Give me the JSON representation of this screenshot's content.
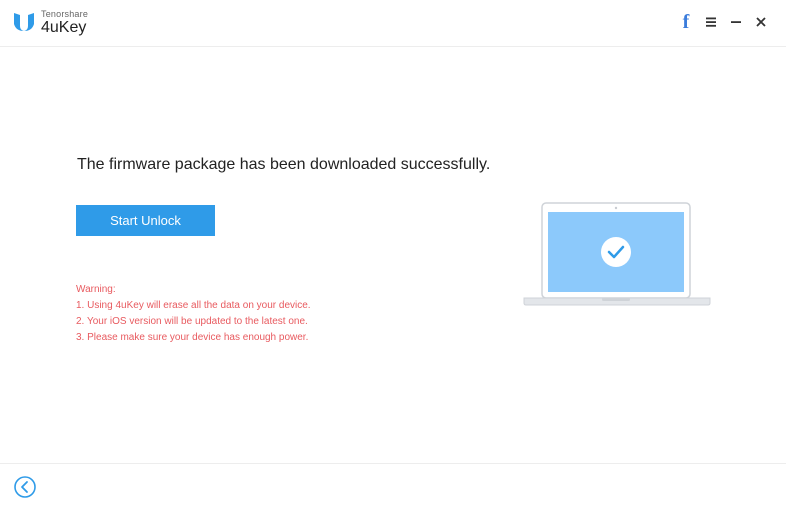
{
  "app": {
    "vendor": "Tenorshare",
    "name": "4uKey"
  },
  "window_controls": {
    "facebook": "f"
  },
  "main": {
    "headline": "The firmware package has been downloaded successfully.",
    "start_button": "Start Unlock",
    "warning": {
      "title": "Warning:",
      "items": [
        "1. Using 4uKey will erase all the data on your device.",
        "2. Your iOS version will be updated to the latest one.",
        "3. Please make sure your device has enough power."
      ]
    }
  },
  "icons": [
    "logo-icon",
    "facebook-icon",
    "menu-icon",
    "minimize-icon",
    "close-icon",
    "laptop-check-icon",
    "back-icon"
  ],
  "colors": {
    "accent": "#2f9be8",
    "warning": "#e85a5f",
    "facebook": "#3b7cdb",
    "screen": "#8cc9fb"
  }
}
